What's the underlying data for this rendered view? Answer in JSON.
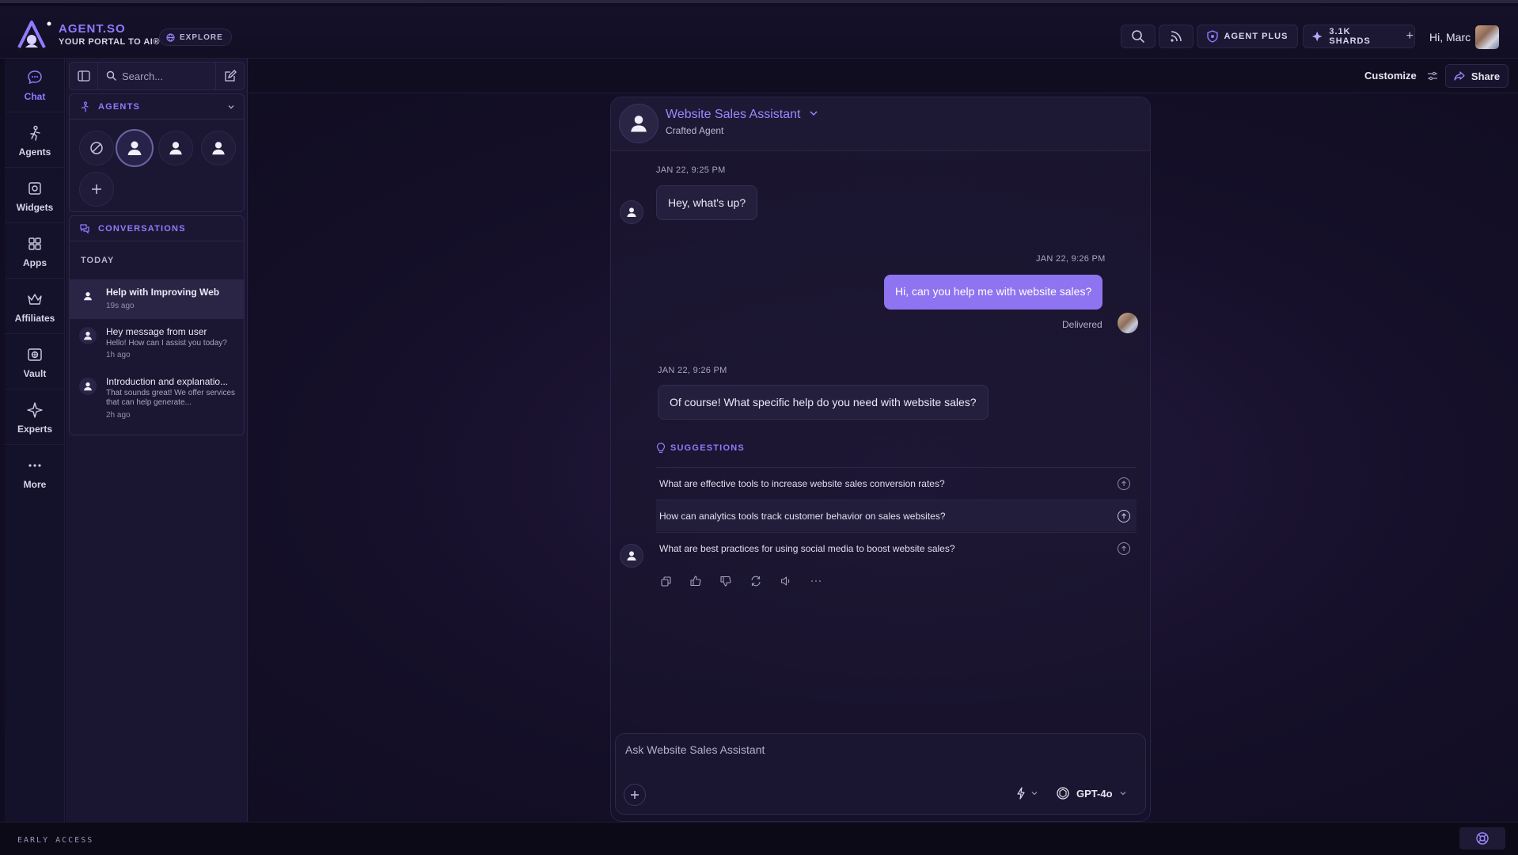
{
  "brand": {
    "title": "AGENT.SO",
    "subtitle": "YOUR PORTAL TO AI®",
    "explore_label": "EXPLORE",
    "accent": "#8f7cff"
  },
  "topbar": {
    "agent_plus_label": "AGENT PLUS",
    "shards_label": "3.1K SHARDS",
    "greeting": "Hi, Marc"
  },
  "rail": {
    "items": [
      {
        "label": "Chat",
        "icon": "chat-icon",
        "active": true
      },
      {
        "label": "Agents",
        "icon": "agents-icon"
      },
      {
        "label": "Widgets",
        "icon": "widgets-icon"
      },
      {
        "label": "Apps",
        "icon": "apps-icon"
      },
      {
        "label": "Affiliates",
        "icon": "crown-icon"
      },
      {
        "label": "Vault",
        "icon": "vault-icon"
      },
      {
        "label": "Experts",
        "icon": "sparkle-icon"
      },
      {
        "label": "More",
        "icon": "more-icon"
      }
    ]
  },
  "sidebar": {
    "search_placeholder": "Search...",
    "agents_heading": "AGENTS",
    "conversations_heading": "CONVERSATIONS",
    "today_label": "TODAY",
    "conversations": [
      {
        "title": "Help with Improving Web",
        "preview": "",
        "time": "19s ago"
      },
      {
        "title": "Hey message from user",
        "preview": "Hello! How can I assist you today?",
        "time": "1h ago"
      },
      {
        "title": "Introduction and explanatio...",
        "preview": "That sounds great! We offer services that can help generate...",
        "time": "2h ago"
      }
    ]
  },
  "main": {
    "customize_label": "Customize",
    "share_label": "Share"
  },
  "chat": {
    "agent_name": "Website Sales Assistant",
    "agent_type": "Crafted Agent",
    "messages": [
      {
        "role": "agent",
        "time": "JAN 22, 9:25 PM",
        "text": "Hey, what's up?"
      },
      {
        "role": "user",
        "time": "JAN 22, 9:26 PM",
        "text": "Hi, can you help me with website sales?",
        "status": "Delivered"
      },
      {
        "role": "agent",
        "time": "JAN 22, 9:26 PM",
        "text": "Of course! What specific help do you need with website sales?"
      }
    ],
    "suggestions_heading": "SUGGESTIONS",
    "suggestions": [
      "What are effective tools to increase website sales conversion rates?",
      "How can analytics tools track customer behavior on sales websites?",
      "What are best practices for using social media to boost website sales?"
    ],
    "composer_placeholder": "Ask Website Sales Assistant",
    "model_label": "GPT-4o"
  },
  "footer": {
    "early_access": "EARLY ACCESS"
  }
}
